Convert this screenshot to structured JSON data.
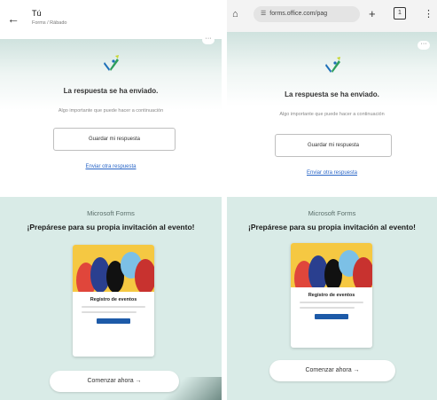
{
  "left": {
    "header": {
      "back_icon": "arrow-left-icon",
      "title": "Tú",
      "subtitle": "Forms / Rábado"
    },
    "more_icon": "more-horizontal-icon",
    "confirmation": {
      "title": "La respuesta se ha enviado.",
      "subtitle": "Algo importante que puede hacer a continuación",
      "save_button": "Guardar mi respuesta",
      "link": "Enviar otra respuesta"
    },
    "promo": {
      "brand": "Microsoft Forms",
      "headline": "¡Prepárese para su propia invitación al evento!",
      "card_title": "Registro de eventos",
      "cta": "Comenzar ahora →"
    }
  },
  "right": {
    "browser": {
      "home_icon": "home-icon",
      "site_icon": "site-settings-icon",
      "url": "forms.office.com/pag",
      "new_tab_icon": "plus-icon",
      "tab_count": "1",
      "menu_icon": "more-vertical-icon"
    },
    "more_icon": "more-horizontal-icon",
    "confirmation": {
      "title": "La respuesta se ha enviado.",
      "subtitle": "Algo importante que puede hacer a continuación",
      "save_button": "Guardar mi respuesta",
      "link": "Enviar otra respuesta"
    },
    "promo": {
      "brand": "Microsoft Forms",
      "headline": "¡Prepárese para su propia invitación al evento!",
      "card_title": "Registro de eventos",
      "cta": "Comenzar ahora →"
    }
  },
  "colors": {
    "link": "#2a66c7",
    "promo_bg": "#d9ebe7",
    "card_button": "#1d5aa8",
    "logo_green": "#2e9e5b",
    "logo_blue": "#1d6fb8",
    "logo_yellow": "#c7d631"
  }
}
